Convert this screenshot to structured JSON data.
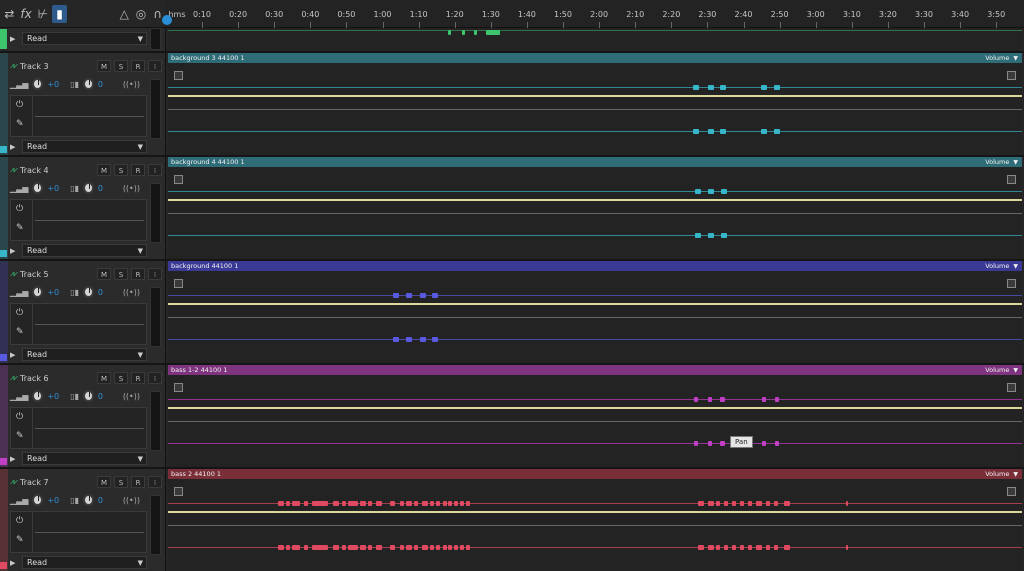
{
  "toolbar": {
    "icons": [
      "swap-icon",
      "fx-icon",
      "multitrack-icon",
      "meters-icon",
      "metronome-icon",
      "monitor-icon",
      "headphones-icon"
    ],
    "fx_label": "fx"
  },
  "ruler": {
    "unit_label": "hms",
    "ticks": [
      "0:10",
      "0:20",
      "0:30",
      "0:40",
      "0:50",
      "1:00",
      "1:10",
      "1:20",
      "1:30",
      "1:40",
      "1:50",
      "2:00",
      "2:10",
      "2:20",
      "2:30",
      "2:40",
      "2:50",
      "3:00",
      "3:10",
      "3:20",
      "3:30",
      "3:40",
      "3:50"
    ]
  },
  "top_track": {
    "read_label": "Read",
    "color": "#3ec46d"
  },
  "tracks": [
    {
      "name": "Track 3",
      "clip": "background 3 44100 1",
      "envelope": "Volume",
      "vol": "+0",
      "pan": "0",
      "read_label": "Read",
      "color": "#2f7a88",
      "bar_color": "#2e6c77",
      "wave_color": "#36b6c8"
    },
    {
      "name": "Track 4",
      "clip": "background 4 44100 1",
      "envelope": "Volume",
      "vol": "+0",
      "pan": "0",
      "read_label": "Read",
      "color": "#2f7a88",
      "bar_color": "#2e6c77",
      "wave_color": "#36b6c8"
    },
    {
      "name": "Track 5",
      "clip": "background 44100 1",
      "envelope": "Volume",
      "vol": "+0",
      "pan": "0",
      "read_label": "Read",
      "color": "#3c3ca0",
      "bar_color": "#3a3a96",
      "wave_color": "#5a5ae0"
    },
    {
      "name": "Track 6",
      "clip": "bass 1-2 44100 1",
      "envelope": "Volume",
      "vol": "+0",
      "pan": "0",
      "read_label": "Read",
      "color": "#8a3a9a",
      "bar_color": "#7e347f",
      "wave_color": "#c13fc4"
    },
    {
      "name": "Track 7",
      "clip": "bass 2 44100 1",
      "envelope": "Volume",
      "vol": "+0",
      "pan": "0",
      "read_label": "Read",
      "color": "#a83a4a",
      "bar_color": "#7a2e38",
      "wave_color": "#e04a60"
    }
  ],
  "labels": {
    "mute": "M",
    "solo": "S",
    "record": "R",
    "more": "⁝"
  },
  "tooltip": {
    "text": "Pan"
  }
}
